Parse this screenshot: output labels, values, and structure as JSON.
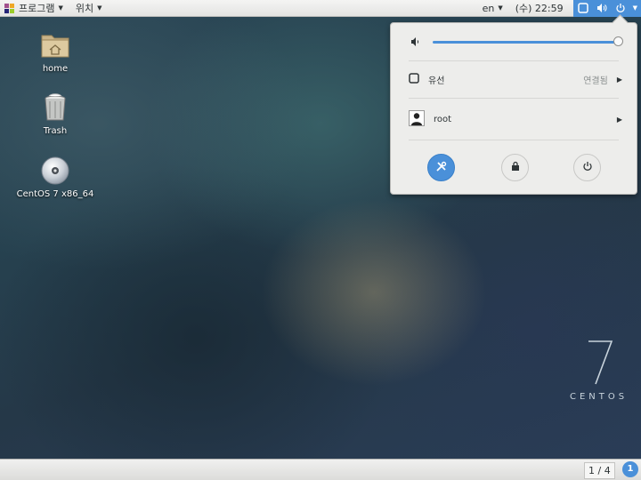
{
  "topbar": {
    "applications_label": "프로그램",
    "places_label": "위치",
    "language": "en",
    "clock": "(수) 22:59",
    "tray_icons": [
      "network-wired-icon",
      "volume-icon",
      "power-icon"
    ]
  },
  "desktop": {
    "icons": [
      {
        "label": "home",
        "icon": "home-folder-icon"
      },
      {
        "label": "Trash",
        "icon": "trash-icon"
      },
      {
        "label": "CentOS 7 x86_64",
        "icon": "disc-icon"
      }
    ],
    "branding": {
      "version": "7",
      "name": "CENTOS"
    }
  },
  "system_menu": {
    "volume_level": 1.0,
    "network": {
      "label": "유선",
      "status": "연결됨"
    },
    "user": {
      "label": "root"
    },
    "buttons": [
      "settings-icon",
      "lock-icon",
      "power-off-icon"
    ]
  },
  "bottombar": {
    "workspace": "1 / 4",
    "notification_count": "1"
  },
  "colors": {
    "accent": "#4a90d9",
    "panel": "#ededeb"
  }
}
